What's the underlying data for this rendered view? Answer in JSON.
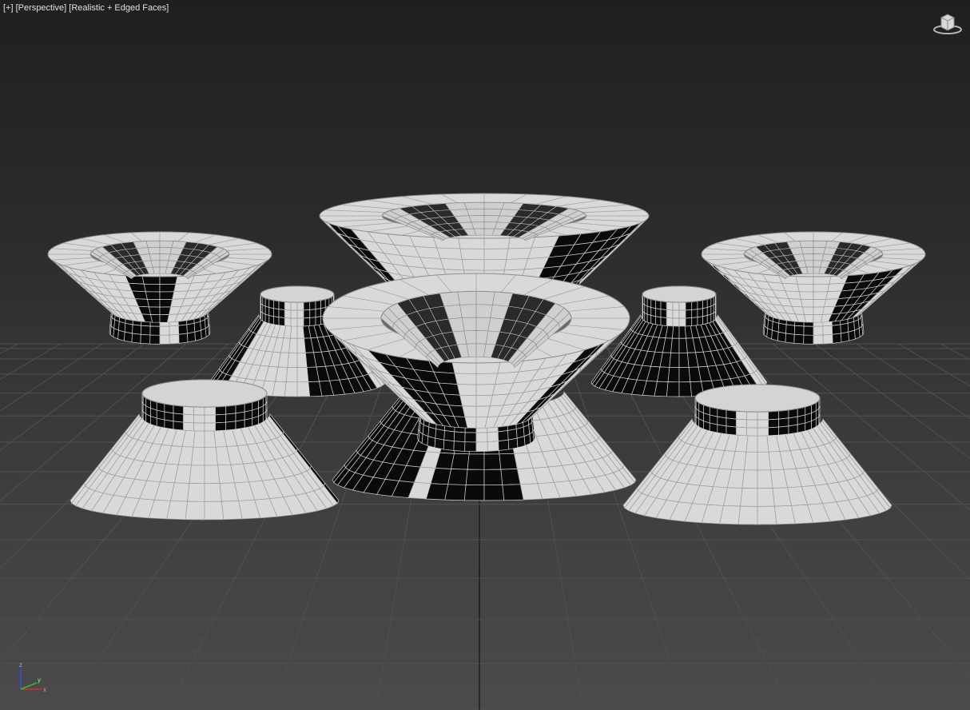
{
  "viewport": {
    "label_plus": "[+]",
    "label_view": "[Perspective]",
    "label_shading": "[Realistic + Edged Faces]"
  },
  "axis": {
    "x": "x",
    "y": "y",
    "z": "z"
  },
  "colors": {
    "background_top": "#1f1f1f",
    "background_bottom": "#4b4b4b",
    "grid": "#505050",
    "grid_axis": "#111111",
    "mesh_light": "#d9d9d9",
    "mesh_dark": "#0a0a0a",
    "mesh_edge": "#f2f2f2",
    "axis_x": "#d03030",
    "axis_y": "#30c030",
    "axis_z": "#3050e0"
  },
  "objects": [
    "funnel-back-center",
    "funnel-back-left",
    "funnel-back-right",
    "cap-mid-left",
    "cap-mid-right",
    "funnel-front-center",
    "cap-front-left",
    "cap-front-right"
  ]
}
